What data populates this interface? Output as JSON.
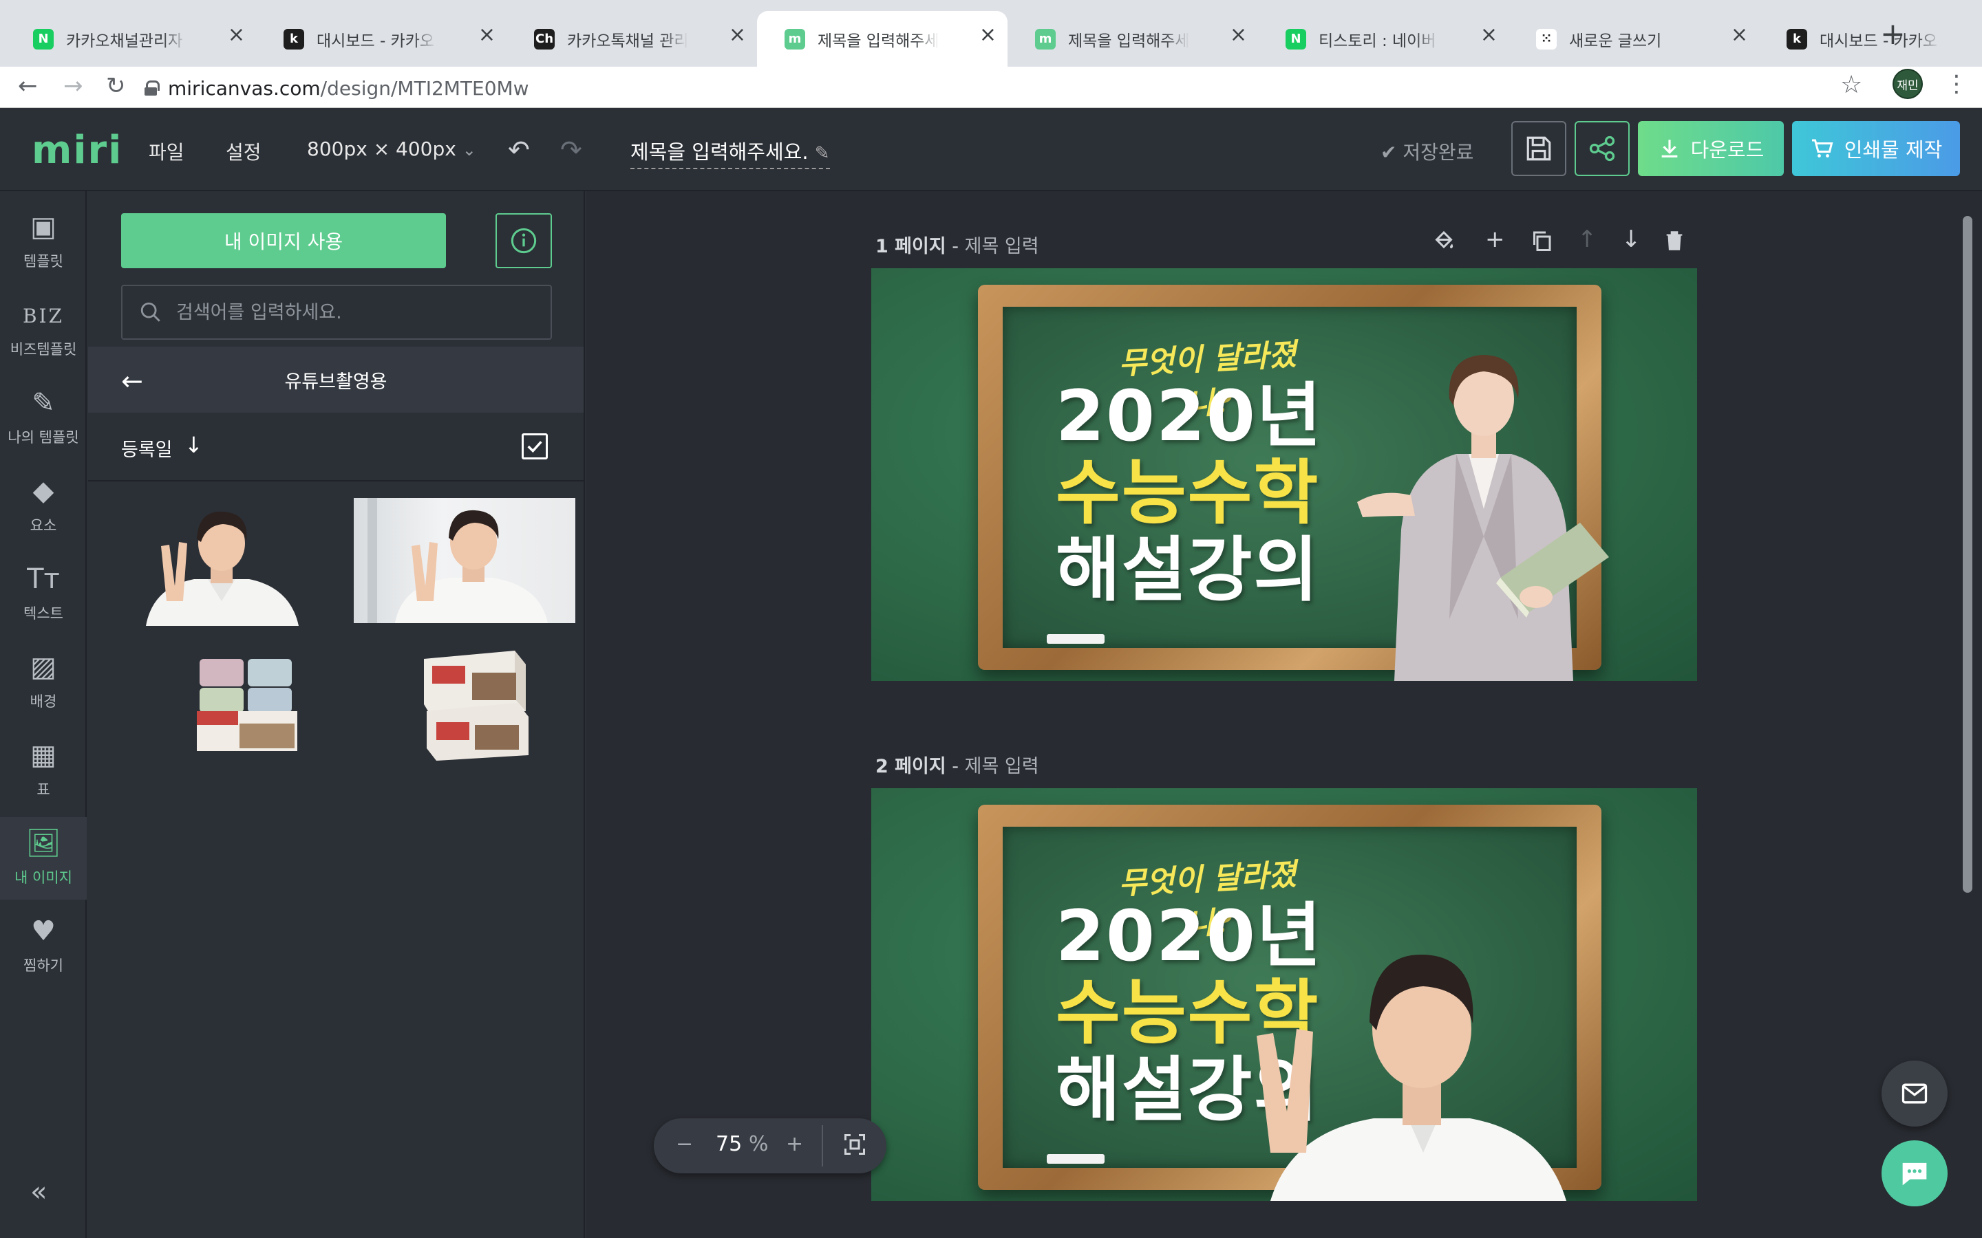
{
  "browser": {
    "tabs": [
      {
        "title": "카카오채널관리자 : 네",
        "icon": "naver-icon",
        "color": "#19ce60",
        "glyph": "N"
      },
      {
        "title": "대시보드 - 카카오 for",
        "icon": "kakao-k-icon",
        "color": "#1e1e1e",
        "glyph": "k"
      },
      {
        "title": "카카오톡채널 관리자센",
        "icon": "kakao-channel-icon",
        "color": "#1e1e1e",
        "glyph": "Ch"
      },
      {
        "title": "제목을 입력해주세요.",
        "icon": "miri-icon",
        "color": "#5ecc8f",
        "glyph": "m"
      },
      {
        "title": "제목을 입력해주세요.",
        "icon": "miri-icon",
        "color": "#5ecc8f",
        "glyph": "m"
      },
      {
        "title": "티스토리 : 네이버 통합",
        "icon": "naver-icon",
        "color": "#19ce60",
        "glyph": "N"
      },
      {
        "title": "새로운 글쓰기",
        "icon": "tistory-icon",
        "color": "#ffffff",
        "glyph": "⁙"
      },
      {
        "title": "대시보드 - 카카오 for",
        "icon": "kakao-k-icon",
        "color": "#1e1e1e",
        "glyph": "k"
      }
    ],
    "active_tab": 3,
    "url_host": "miricanvas.com",
    "url_path": "/design/MTI2MTE0Mw",
    "profile": "재민"
  },
  "app": {
    "logo": "miri",
    "menu_file": "파일",
    "menu_settings": "설정",
    "canvas_size": "800px × 400px",
    "doc_title": "제목을 입력해주세요.",
    "save_status": "저장완료",
    "download_label": "다운로드",
    "print_label": "인쇄물 제작",
    "colors": {
      "accent": "#5ecc8f",
      "print": "#4b9be6"
    }
  },
  "rail": [
    {
      "label": "템플릿",
      "icon": "template-icon",
      "glyph": "▣"
    },
    {
      "label": "비즈템플릿",
      "icon": "biz-icon",
      "glyph": "BIZ"
    },
    {
      "label": "나의 템플릿",
      "icon": "my-template-icon",
      "glyph": "✎"
    },
    {
      "label": "요소",
      "icon": "elements-icon",
      "glyph": "◆"
    },
    {
      "label": "텍스트",
      "icon": "text-icon",
      "glyph": "Tт"
    },
    {
      "label": "배경",
      "icon": "background-icon",
      "glyph": "▨"
    },
    {
      "label": "표",
      "icon": "table-icon",
      "glyph": "▦"
    },
    {
      "label": "내 이미지",
      "icon": "my-image-icon",
      "glyph": "🖼"
    },
    {
      "label": "찜하기",
      "icon": "heart-icon",
      "glyph": "♥"
    }
  ],
  "rail_active": 7,
  "panel": {
    "use_image_button": "내 이미지 사용",
    "search_placeholder": "검색어를 입력하세요.",
    "folder_name": "유튜브촬영용",
    "sort_label": "등록일"
  },
  "pages": [
    {
      "num": "1 페이지",
      "title": "제목 입력"
    },
    {
      "num": "2 페이지",
      "title": "제목 입력"
    }
  ],
  "design": {
    "subtitle": "무엇이 달라졌나?",
    "line1": "2020년",
    "line2": "수능수학",
    "line3": "해설강의"
  },
  "zoom": {
    "minus": "−",
    "value": "75",
    "unit": "%",
    "plus": "+"
  }
}
